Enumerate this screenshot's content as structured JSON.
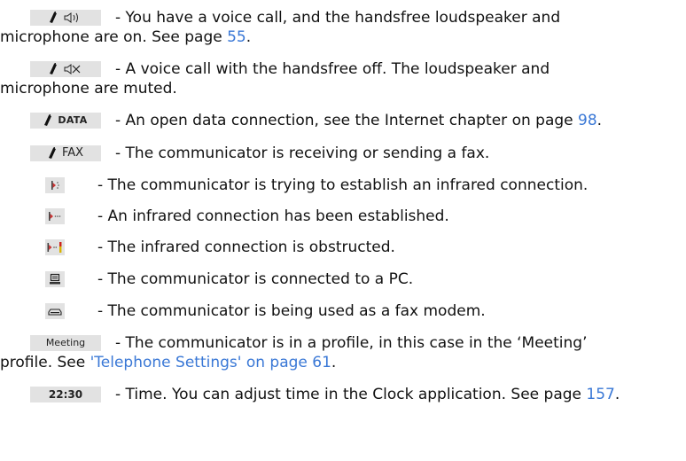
{
  "entries": [
    {
      "id": "voice-handsfree-on",
      "badge": {
        "icons": [
          "phone-icon",
          "speaker-icon"
        ]
      },
      "text": "- You have a voice call, and the handsfree loudspeaker and",
      "text2_pre": "microphone are on. See page ",
      "text2_link": "55",
      "text2_post": "."
    },
    {
      "id": "voice-handsfree-off",
      "badge": {
        "icons": [
          "phone-icon",
          "speaker-muted-icon"
        ]
      },
      "text": "- A voice call with the handsfree off. The loudspeaker and",
      "text2_pre": "microphone are muted."
    },
    {
      "id": "data-connection",
      "badge": {
        "icons": [
          "phone-icon"
        ],
        "label": "DATA"
      },
      "text_pre": "- An open data connection, see the Internet chapter on page ",
      "text_link": "98",
      "text_post": "."
    },
    {
      "id": "fax",
      "badge": {
        "icons": [
          "phone-icon"
        ],
        "label": "FAX"
      },
      "text": "- The communicator is receiving or sending a fax."
    },
    {
      "id": "infrared-trying",
      "badge": {
        "icons": [
          "infrared-trying-icon"
        ]
      },
      "text": "- The communicator is trying to establish an infrared connection."
    },
    {
      "id": "infrared-established",
      "badge": {
        "icons": [
          "infrared-established-icon"
        ]
      },
      "text": "- An infrared connection has been established."
    },
    {
      "id": "infrared-obstructed",
      "badge": {
        "icons": [
          "infrared-obstructed-icon"
        ]
      },
      "text": "- The infrared connection is obstructed."
    },
    {
      "id": "pc-connected",
      "badge": {
        "icons": [
          "pc-icon"
        ]
      },
      "text": "- The communicator is connected to a PC."
    },
    {
      "id": "fax-modem",
      "badge": {
        "icons": [
          "modem-icon"
        ]
      },
      "text": "- The communicator is being used as a fax modem."
    },
    {
      "id": "profile",
      "badge": {
        "label": "Meeting"
      },
      "text": "- The communicator is in a profile, in this case in the ‘Meeting’",
      "text2_pre": "profile. See ",
      "text2_link": "'Telephone Settings' on page 61",
      "text2_post": "."
    },
    {
      "id": "time",
      "badge": {
        "label": "22:30"
      },
      "text_pre": "- Time. You can adjust time in the Clock application. See page ",
      "text_link": "157",
      "text_post": "."
    }
  ],
  "colors": {
    "link": "#3a78d6",
    "badge_bg": "#e2e2e2"
  }
}
